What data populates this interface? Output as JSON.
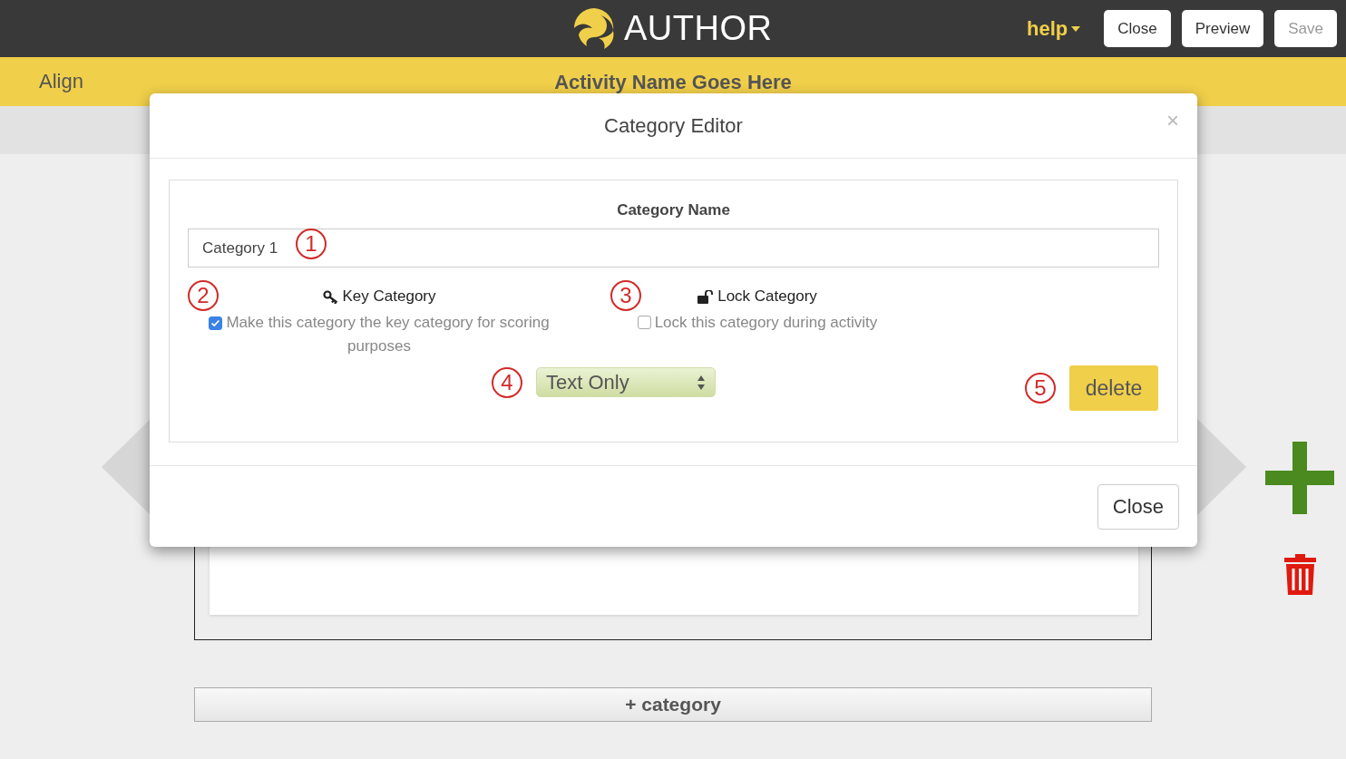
{
  "header": {
    "logo_text": "AUTHOR",
    "help": "help",
    "buttons": [
      {
        "label": "Close",
        "disabled": false
      },
      {
        "label": "Preview",
        "disabled": false
      },
      {
        "label": "Save",
        "disabled": true
      }
    ]
  },
  "subheader": {
    "mode": "Align",
    "activity_name": "Activity Name Goes Here"
  },
  "canvas": {
    "add_category": "+ category"
  },
  "modal": {
    "title": "Category Editor",
    "close_symbol": "×",
    "section_label": "Category Name",
    "category_name": "Category 1",
    "key": {
      "label": "Key Category",
      "checkbox_text": "Make this category the key category for scoring purposes",
      "checked": true
    },
    "lock": {
      "label": "Lock Category",
      "checkbox_text": "Lock this category during activity",
      "checked": false
    },
    "display_type": "Text Only",
    "delete_label": "delete",
    "footer_close": "Close"
  },
  "annotations": [
    "1",
    "2",
    "3",
    "4",
    "5"
  ]
}
